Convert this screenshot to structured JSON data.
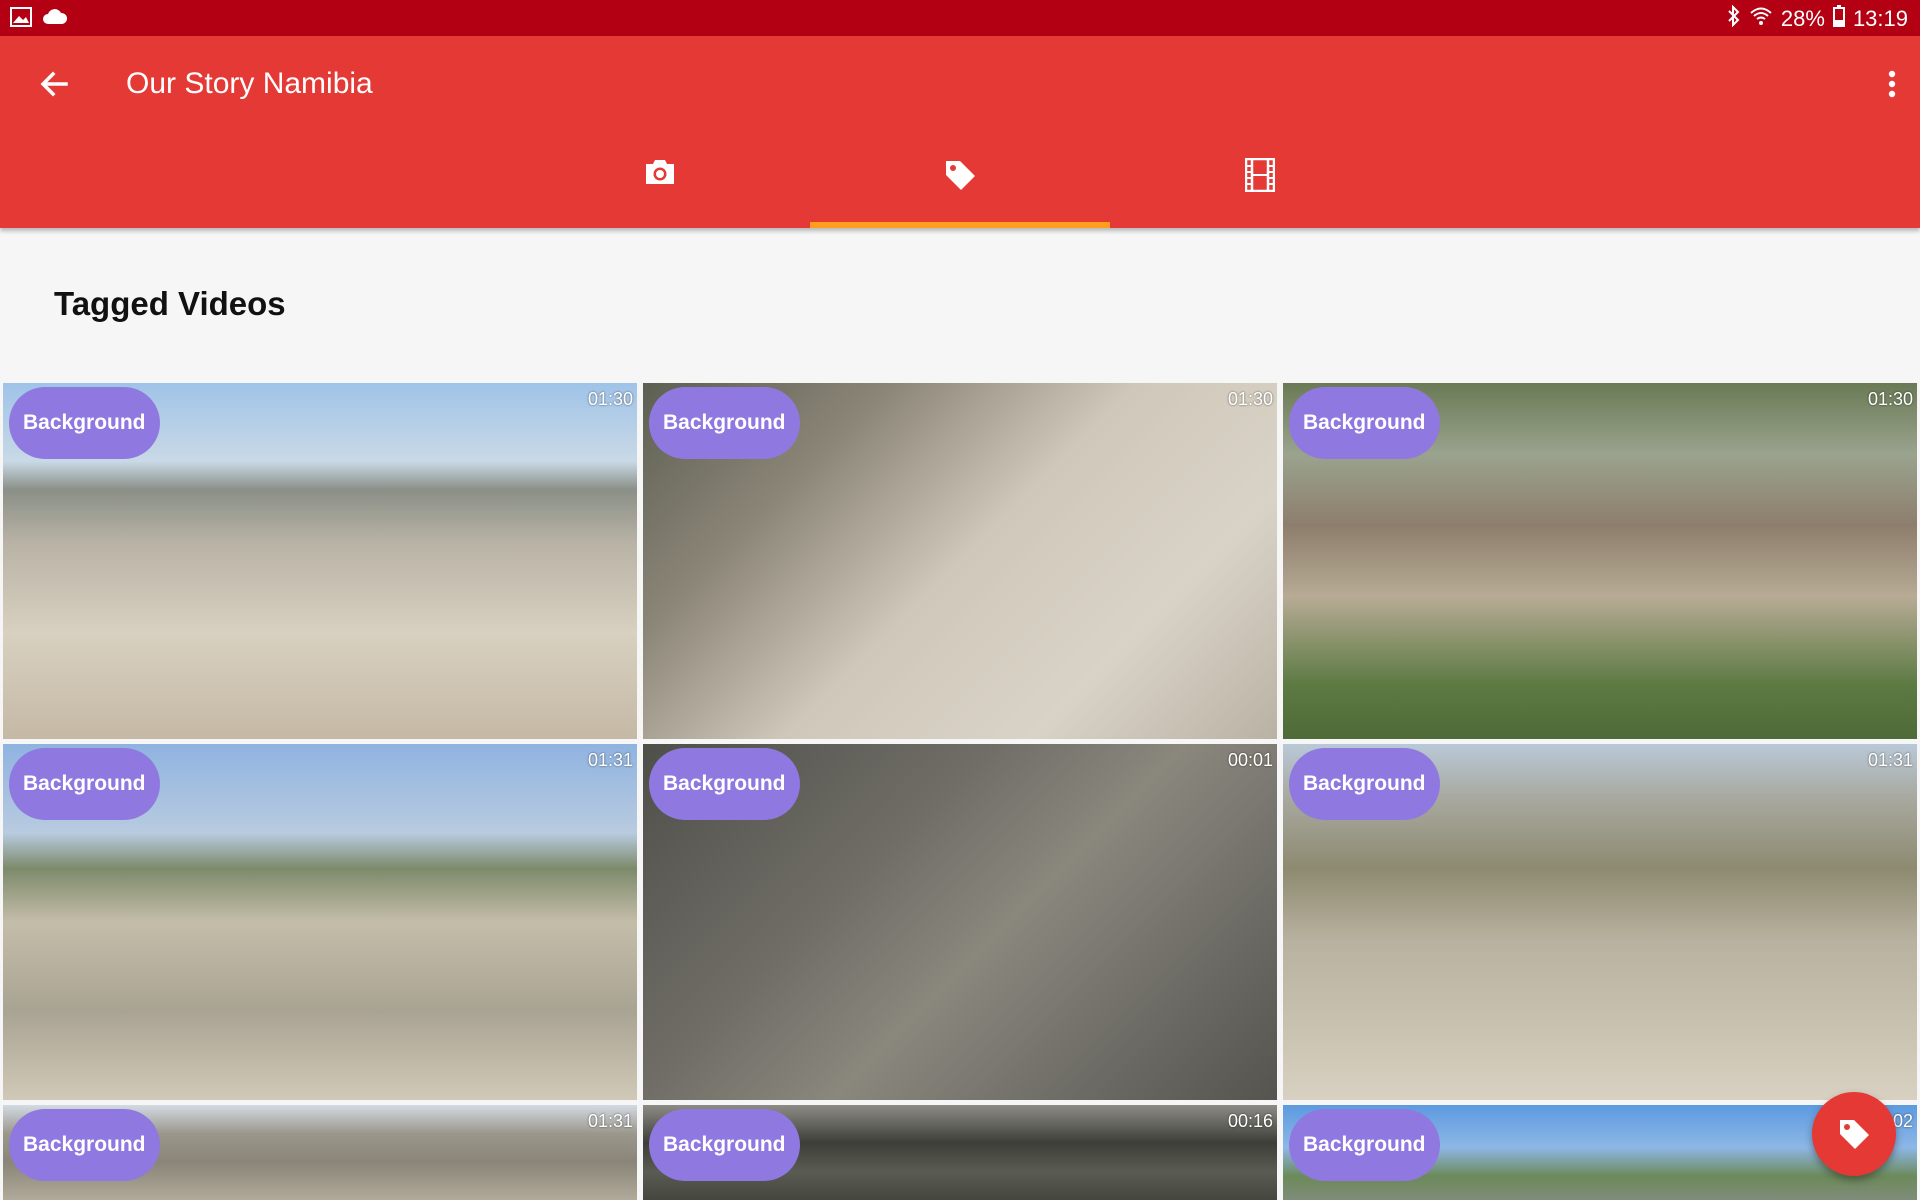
{
  "status": {
    "battery": "28%",
    "time": "13:19"
  },
  "appbar": {
    "title": "Our Story Namibia"
  },
  "tabs": [
    {
      "icon": "camera-icon"
    },
    {
      "icon": "tag-icon"
    },
    {
      "icon": "film-icon"
    }
  ],
  "active_tab": 1,
  "section": {
    "title": "Tagged Videos"
  },
  "videos": [
    {
      "tag": "Background",
      "duration": "01:30"
    },
    {
      "tag": "Background",
      "duration": "01:30"
    },
    {
      "tag": "Background",
      "duration": "01:30"
    },
    {
      "tag": "Background",
      "duration": "01:31"
    },
    {
      "tag": "Background",
      "duration": "00:01"
    },
    {
      "tag": "Background",
      "duration": "01:31"
    },
    {
      "tag": "Background",
      "duration": "01:31"
    },
    {
      "tag": "Background",
      "duration": "00:16"
    },
    {
      "tag": "Background",
      "duration": "02"
    }
  ],
  "colors": {
    "primary": "#e53935",
    "status_bar": "#b30013",
    "accent": "#ff9d1f",
    "chip": "#8f79e0"
  }
}
